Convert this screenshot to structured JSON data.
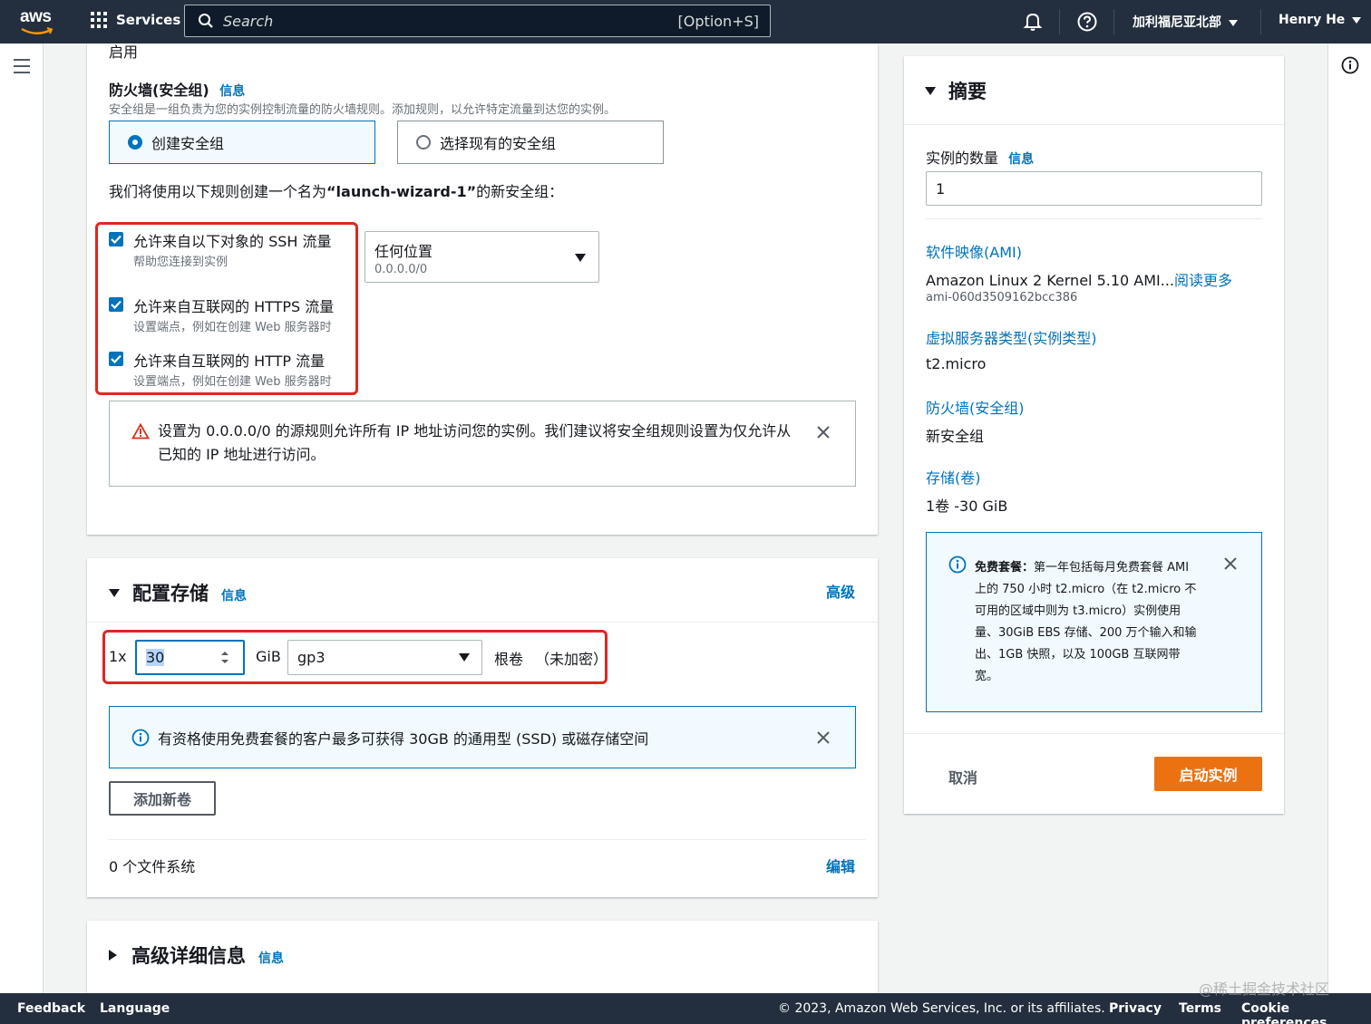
{
  "topnav": {
    "logo_text": "aws",
    "services_label": "Services",
    "search_placeholder": "Search",
    "search_shortcut": "[Option+S]",
    "region_label": "加利福尼亚北部",
    "user_label": "Henry He"
  },
  "security_group": {
    "partial_top_text": "启用",
    "title": "防火墙(安全组)",
    "info": "信息",
    "description": "安全组是一组负责为您的实例控制流量的防火墙规则。添加规则，以允许特定流量到达您的实例。",
    "option_create": "创建安全组",
    "option_existing": "选择现有的安全组",
    "rules_intro_prefix": "我们将使用以下规则创建一个名为",
    "rules_intro_name": "“launch-wizard-1”",
    "rules_intro_suffix": "的新安全组：",
    "rules": [
      {
        "label": "允许来自以下对象的 SSH 流量",
        "desc": "帮助您连接到实例",
        "checked": true
      },
      {
        "label": "允许来自互联网的 HTTPS 流量",
        "desc": "设置端点，例如在创建 Web 服务器时",
        "checked": true
      },
      {
        "label": "允许来自互联网的 HTTP 流量",
        "desc": "设置端点，例如在创建 Web 服务器时",
        "checked": true
      }
    ],
    "ssh_source_label": "任何位置",
    "ssh_source_value": "0.0.0.0/0",
    "warning_text": "设置为 0.0.0.0/0 的源规则允许所有 IP 地址访问您的实例。我们建议将安全组规则设置为仅允许从已知的 IP 地址进行访问。"
  },
  "storage": {
    "title": "配置存储",
    "info": "信息",
    "advanced_link": "高级",
    "count_prefix": "1x",
    "size_value": "30",
    "unit": "GiB",
    "volume_type": "gp3",
    "root_label": "根卷",
    "encryption_label": "（未加密）",
    "info_alert": "有资格使用免费套餐的客户最多可获得 30GB 的通用型 (SSD) 或磁存储空间",
    "add_volume_button": "添加新卷",
    "filesystems_label": "0 个文件系统",
    "edit_link": "编辑"
  },
  "advanced": {
    "title": "高级详细信息",
    "info": "信息"
  },
  "summary": {
    "title": "摘要",
    "instance_count_label": "实例的数量",
    "info": "信息",
    "instance_count_value": "1",
    "ami_heading": "软件映像(AMI)",
    "ami_name": "Amazon Linux 2 Kernel 5.10 AMI...",
    "ami_readmore": "阅读更多",
    "ami_id": "ami-060d3509162bcc386",
    "instance_type_heading": "虚拟服务器类型(实例类型)",
    "instance_type_value": "t2.micro",
    "firewall_heading": "防火墙(安全组)",
    "firewall_value": "新安全组",
    "storage_heading": "存储(卷)",
    "storage_value": "1卷 -30 GiB",
    "free_tier_title": "免费套餐：",
    "free_tier_text": "第一年包括每月免费套餐 AMI 上的 750 小时 t2.micro（在 t2.micro 不可用的区域中则为 t3.micro）实例使用量、30GiB EBS 存储、200 万个输入和输出、1GB 快照，以及 100GB 互联网带宽。",
    "cancel_button": "取消",
    "launch_button": "启动实例"
  },
  "footer": {
    "feedback": "Feedback",
    "language": "Language",
    "copyright": "© 2023, Amazon Web Services, Inc. or its affiliates.",
    "privacy": "Privacy",
    "terms": "Terms",
    "cookies": "Cookie preferences"
  },
  "watermark": "@稀土掘金技术社区",
  "colors": {
    "nav_bg": "#232f3e",
    "link": "#0073bb",
    "primary_button": "#ec7211",
    "highlight_box": "#e0271f"
  },
  "icons": [
    "aws-logo",
    "grid-icon",
    "search-icon",
    "bell-icon",
    "help-icon",
    "menu-icon",
    "info-icon",
    "warning-icon",
    "close-icon",
    "caret-down-icon",
    "checkbox-icon"
  ]
}
